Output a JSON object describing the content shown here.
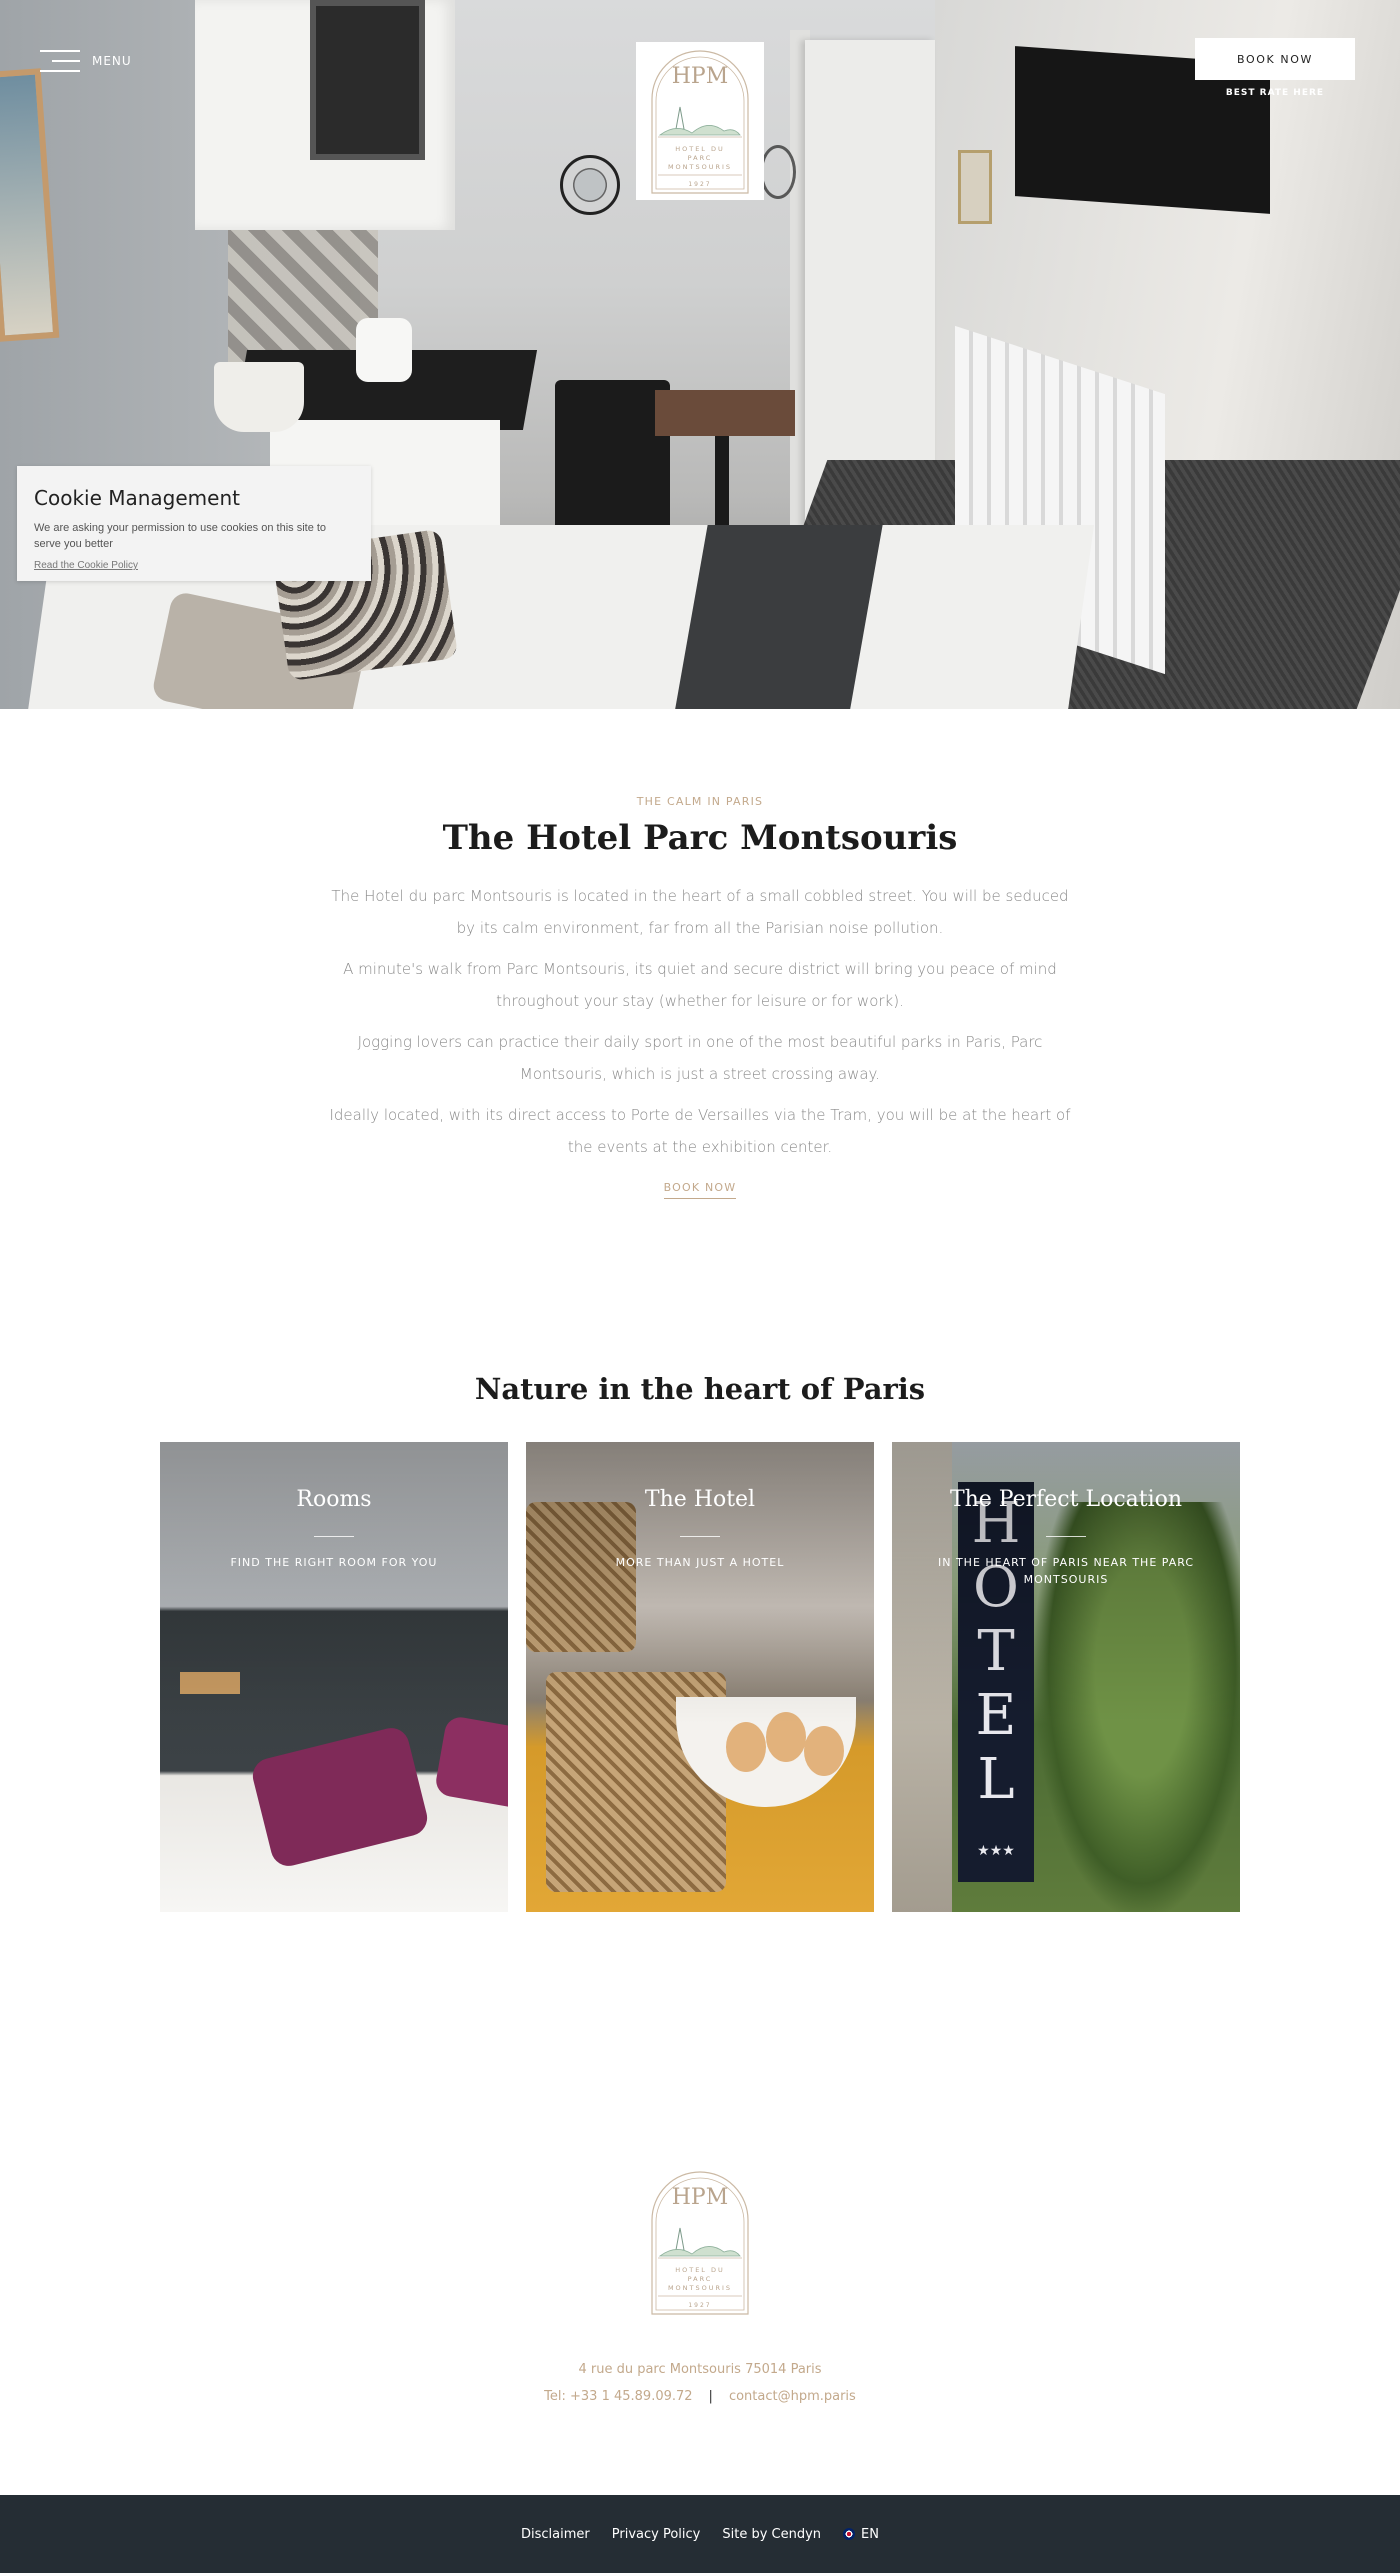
{
  "header": {
    "menu_label": "MENU",
    "book_now": "BOOK NOW",
    "best_rate": "BEST RATE HERE",
    "logo_monogram": "HPM",
    "logo_text_line1": "HOTEL DU",
    "logo_text_line2": "PARC",
    "logo_text_line3": "MONTSOURIS",
    "logo_year": "1927"
  },
  "cookie": {
    "title": "Cookie Management",
    "text": "We are asking your permission to use cookies on this site to serve you better",
    "link": "Read the Cookie Policy"
  },
  "intro": {
    "eyebrow": "THE CALM IN PARIS",
    "title": "The Hotel Parc Montsouris",
    "paragraphs": [
      "The Hotel du parc Montsouris is located in the heart of a small cobbled street. You will be seduced by its calm environment, far from all the Parisian noise pollution.",
      "A minute's walk from Parc Montsouris, its quiet and secure district will bring you peace of mind throughout your stay (whether for leisure or for work).",
      "Jogging lovers can practice their daily sport in one of the most beautiful parks in Paris, Parc Montsouris, which is just a street crossing away.",
      "Ideally located, with its direct access to Porte de Versailles via the Tram, you will be at the heart of the events at the exhibition center."
    ],
    "book_link": "BOOK NOW"
  },
  "nature": {
    "title": "Nature in the heart of Paris",
    "cards": [
      {
        "title": "Rooms",
        "subtitle": "FIND THE RIGHT ROOM FOR YOU"
      },
      {
        "title": "The Hotel",
        "subtitle": "MORE THAN JUST A HOTEL"
      },
      {
        "title": "The Perfect Location",
        "subtitle": "IN THE HEART OF PARIS NEAR THE PARC MONTSOURIS"
      }
    ],
    "sign_text": "HOTEL"
  },
  "footer": {
    "address": "4 rue du parc Montsouris 75014 Paris",
    "phone": "Tel: +33 1 45.89.09.72",
    "separator": "|",
    "email": "contact@hpm.paris",
    "links": [
      "Disclaimer",
      "Privacy Policy",
      "Site by Cendyn"
    ],
    "lang": "EN"
  },
  "colors": {
    "accent": "#c3a98c",
    "footer_bar": "#252d34"
  }
}
